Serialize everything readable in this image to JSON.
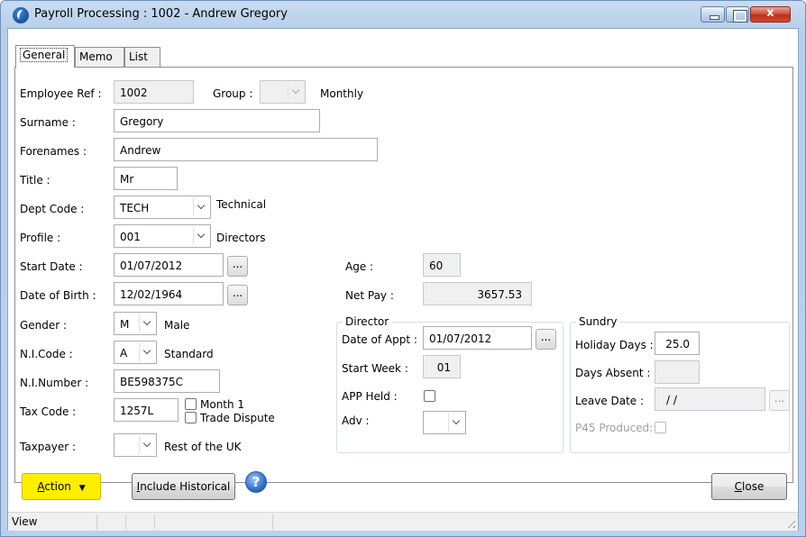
{
  "window": {
    "title": "Payroll Processing : 1002 - Andrew Gregory",
    "close_glyph": "x"
  },
  "tabs": [
    {
      "label": "General"
    },
    {
      "label": "Memo"
    },
    {
      "label": "List"
    }
  ],
  "employee": {
    "ref_label": "Employee Ref :",
    "ref_value": "1002",
    "group_label": "Group :",
    "group_value": "",
    "group_desc": "Monthly",
    "surname_label": "Surname :",
    "surname_value": "Gregory",
    "forenames_label": "Forenames :",
    "forenames_value": "Andrew",
    "title_label": "Title :",
    "title_value": "Mr",
    "dept_label": "Dept Code :",
    "dept_value": "TECH",
    "dept_desc": "Technical",
    "profile_label": "Profile :",
    "profile_value": "001",
    "profile_desc": "Directors",
    "start_label": "Start Date :",
    "start_value": "01/07/2012",
    "dob_label": "Date of Birth :",
    "dob_value": "12/02/1964",
    "gender_label": "Gender :",
    "gender_value": "M",
    "gender_desc": "Male",
    "nicode_label": "N.I.Code :",
    "nicode_value": "A",
    "nicode_desc": "Standard",
    "ninumber_label": "N.I.Number :",
    "ninumber_value": "BE598375C",
    "taxcode_label": "Tax Code :",
    "taxcode_value": "1257L",
    "month1_label": "Month 1",
    "trade_dispute_label": "Trade Dispute",
    "taxpayer_label": "Taxpayer :",
    "taxpayer_value": "",
    "taxpayer_desc": "Rest of the UK",
    "age_label": "Age :",
    "age_value": "60",
    "netpay_label": "Net Pay :",
    "netpay_value": "3657.53",
    "ellipsis": "..."
  },
  "director": {
    "title": "Director",
    "appt_label": "Date of Appt :",
    "appt_value": "01/07/2012",
    "start_week_label": "Start Week :",
    "start_week_value": "01",
    "app_held_label": "APP Held :",
    "adv_label": "Adv :",
    "adv_value": ""
  },
  "sundry": {
    "title": "Sundry",
    "holiday_label": "Holiday Days :",
    "holiday_value": "25.0",
    "absent_label": "Days Absent :",
    "absent_value": "",
    "leave_label": "Leave Date :",
    "leave_value": "/ /",
    "p45_label": "P45 Produced:"
  },
  "buttons": {
    "action_access": "A",
    "action_rest": "ction",
    "include_access": "I",
    "include_rest": "nclude Historical",
    "close_access": "C",
    "close_rest": "lose",
    "help_glyph": "?"
  },
  "status": {
    "mode": "View"
  },
  "colors": {
    "action_button": "#ffee00",
    "title_bar": "#c9dcf1"
  }
}
